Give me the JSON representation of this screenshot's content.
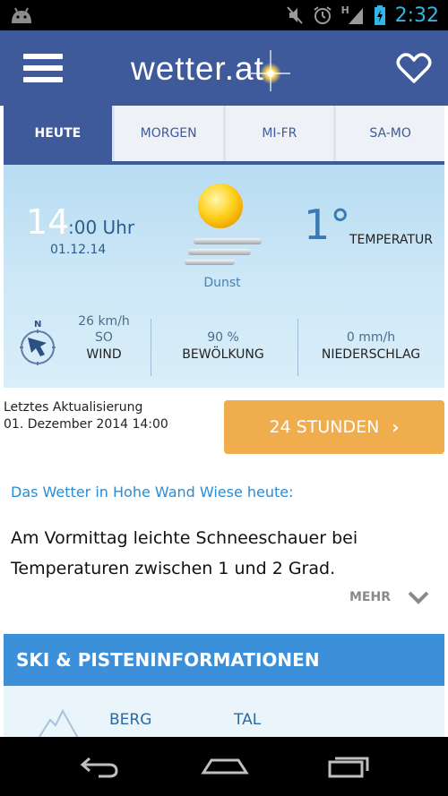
{
  "status_bar": {
    "time": "2:32",
    "icons": [
      "android-debug-icon",
      "muted-icon",
      "alarm-icon",
      "signal-icon",
      "battery-charging-icon"
    ],
    "signal_letter": "H"
  },
  "app_bar": {
    "logo_text": "wetter.at",
    "menu_icon": "hamburger-menu-icon",
    "favorite_icon": "heart-icon"
  },
  "tabs": [
    {
      "label": "HEUTE",
      "active": true
    },
    {
      "label": "MORGEN",
      "active": false
    },
    {
      "label": "MI-FR",
      "active": false
    },
    {
      "label": "SA-MO",
      "active": false
    }
  ],
  "current": {
    "hour": "14",
    "time_suffix": ":00 Uhr",
    "date": "01.12.14",
    "condition": "Dunst",
    "condition_icon": "sun-with-haze-icon",
    "temperature": "1°",
    "temperature_label": "TEMPERATUR"
  },
  "stats": {
    "wind": {
      "speed": "26 km/h",
      "direction": "SO",
      "label": "WIND"
    },
    "clouds": {
      "value": "90 %",
      "label": "BEWÖLKUNG"
    },
    "precipitation": {
      "value": "0 mm/h",
      "label": "NIEDERSCHLAG"
    }
  },
  "update": {
    "label": "Letztes Aktualisierung",
    "value": "01. Dezember 2014 14:00"
  },
  "cta": {
    "label": "24 STUNDEN",
    "chevron": "›"
  },
  "forecast_text": {
    "heading": "Das Wetter in Hohe Wand Wiese heute:",
    "body": "Am Vormittag leichte Schneeschauer bei Temperaturen zwischen 1 und 2 Grad.",
    "more_label": "MEHR"
  },
  "ski": {
    "title": "SKI & PISTENINFORMATIONEN",
    "col_mountain": "BERG",
    "col_valley": "TAL"
  },
  "colors": {
    "primary": "#3e5a9b",
    "accent_orange": "#f0ad4e",
    "link_blue": "#2c8bd2",
    "ski_header": "#3c8fd9",
    "status_clock": "#33b5e5"
  }
}
